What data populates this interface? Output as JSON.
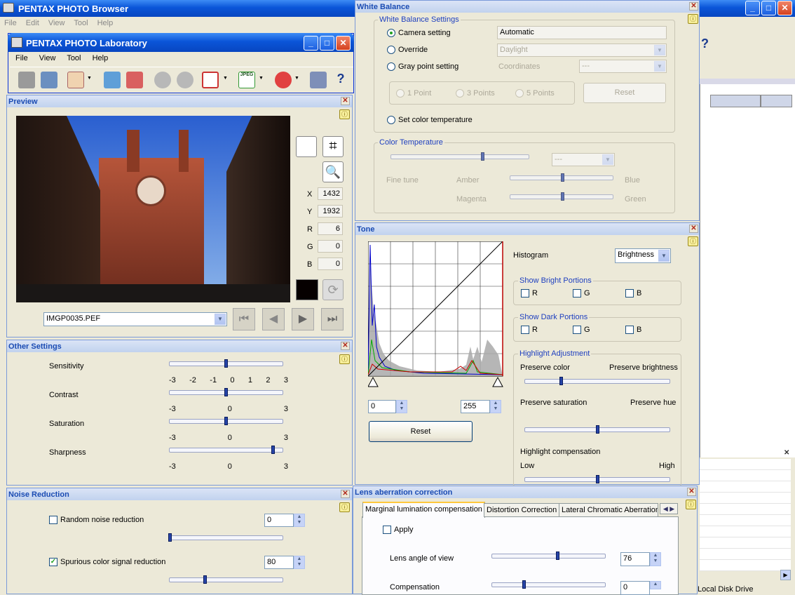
{
  "browser": {
    "title": "PENTAX PHOTO Browser",
    "menu": [
      "File",
      "Edit",
      "View",
      "Tool",
      "Help"
    ]
  },
  "lab": {
    "title": "PENTAX PHOTO Laboratory",
    "menu": [
      "File",
      "View",
      "Tool",
      "Help"
    ],
    "toolbar_icons": [
      "develop-icon",
      "save-icon",
      "hand-icon",
      "open-icon",
      "batch-icon",
      "undo-icon",
      "redo-icon",
      "compare-icon",
      "jpeg-format-icon",
      "rotate-icon",
      "settings-icon",
      "help-icon"
    ]
  },
  "preview": {
    "title": "Preview",
    "x_label": "X",
    "x_value": "1432",
    "y_label": "Y",
    "y_value": "1932",
    "r_label": "R",
    "r_value": "6",
    "g_label": "G",
    "g_value": "0",
    "b_label": "B",
    "b_value": "0",
    "filename": "IMGP0035.PEF"
  },
  "other": {
    "title": "Other Settings",
    "sensitivity": "Sensitivity",
    "contrast": "Contrast",
    "saturation": "Saturation",
    "sharpness": "Sharpness",
    "ticks7": [
      "-3",
      "-2",
      "-1",
      "0",
      "1",
      "2",
      "3"
    ],
    "ticks3": [
      "-3",
      "0",
      "3"
    ],
    "levels": {
      "sensitivity": 0,
      "contrast": 0,
      "saturation": 0,
      "sharpness": 2.6
    }
  },
  "noise": {
    "title": "Noise Reduction",
    "random_label": "Random noise reduction",
    "random_value": "0",
    "spurious_label": "Spurious color signal reduction",
    "spurious_value": "80"
  },
  "wb": {
    "title": "White Balance",
    "group": "White Balance Settings",
    "camera": "Camera setting",
    "camera_value": "Automatic",
    "override": "Override",
    "override_value": "Daylight",
    "gray": "Gray point setting",
    "coords": "Coordinates",
    "coords_value": "---",
    "point1": "1 Point",
    "point3": "3 Points",
    "point5": "5 Points",
    "reset": "Reset",
    "set_temp": "Set color temperature",
    "temp_group": "Color Temperature",
    "temp_value": "---",
    "fine_tune": "Fine tune",
    "amber": "Amber",
    "blue": "Blue",
    "magenta": "Magenta",
    "green": "Green"
  },
  "tone": {
    "title": "Tone",
    "histogram": "Histogram",
    "hist_mode": "Brightness",
    "bright_group": "Show Bright Portions",
    "dark_group": "Show Dark Portions",
    "r": "R",
    "g": "G",
    "b": "B",
    "highlight_group": "Highlight Adjustment",
    "preserve_color": "Preserve color",
    "preserve_brightness": "Preserve brightness",
    "preserve_saturation": "Preserve saturation",
    "preserve_hue": "Preserve hue",
    "highlight_comp": "Highlight compensation",
    "low": "Low",
    "high": "High",
    "in_low": "0",
    "in_high": "255",
    "reset": "Reset"
  },
  "lens": {
    "title": "Lens aberration correction",
    "tabs": [
      "Marginal lumination compensation",
      "Distortion Correction",
      "Lateral Chromatic Aberration"
    ],
    "apply": "Apply",
    "angle_label": "Lens angle of view",
    "angle_value": "76",
    "comp_label": "Compensation",
    "comp_value": "0"
  },
  "explorer": {
    "drive": "Local Disk Drive"
  },
  "colors": {
    "xp_blue": "#0a55d8",
    "panel": "#ece9d8",
    "header_text": "#1a4bb3"
  }
}
